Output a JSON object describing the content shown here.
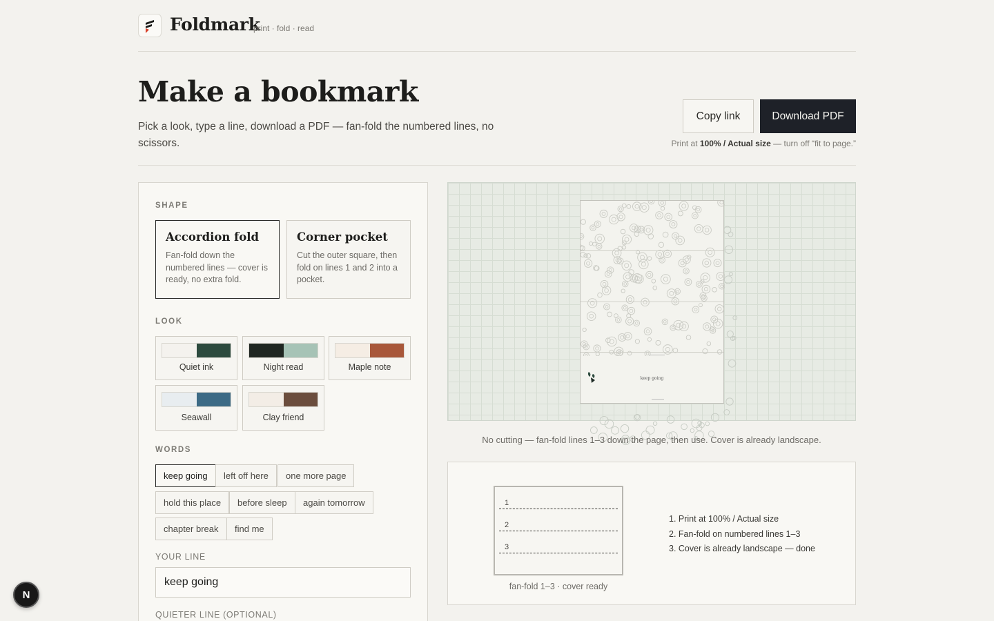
{
  "header": {
    "brand": "Foldmark",
    "tagline": "print · fold · read"
  },
  "hero": {
    "title": "Make a bookmark",
    "subtitle": "Pick a look, type a line, download a PDF — fan-fold the numbered lines, no scissors.",
    "copy_link_label": "Copy link",
    "download_label": "Download PDF",
    "print_note_prefix": "Print at ",
    "print_note_bold": "100% / Actual size",
    "print_note_suffix": " — turn off “fit to page.”"
  },
  "panel": {
    "shape_label": "SHAPE",
    "shapes": [
      {
        "title": "Accordion fold",
        "desc": "Fan-fold down the numbered lines — cover is ready, no extra fold.",
        "selected": true
      },
      {
        "title": "Corner pocket",
        "desc": "Cut the outer square, then fold on lines 1 and 2 into a pocket.",
        "selected": false
      }
    ],
    "look_label": "LOOK",
    "looks": [
      {
        "name": "Quiet ink",
        "colors": [
          "#f4f2ee",
          "#2c4a3e"
        ]
      },
      {
        "name": "Night read",
        "colors": [
          "#1f2621",
          "#a6c3b6"
        ]
      },
      {
        "name": "Maple note",
        "colors": [
          "#f5ede4",
          "#a8573a"
        ]
      },
      {
        "name": "Seawall",
        "colors": [
          "#e8edf0",
          "#3c6a85"
        ]
      },
      {
        "name": "Clay friend",
        "colors": [
          "#f3ede6",
          "#6b4d3d"
        ]
      }
    ],
    "words_label": "WORDS",
    "words": [
      "keep going",
      "left off here",
      "one more page",
      "hold this place",
      "before sleep",
      "again tomorrow",
      "chapter break",
      "find me"
    ],
    "selected_word": "keep going",
    "your_line_label": "YOUR LINE",
    "your_line_value": "keep going",
    "quieter_line_label": "QUIETER LINE (OPTIONAL)"
  },
  "preview": {
    "bookmark_word": "keep going",
    "caption": "No cutting — fan-fold lines 1–3 down the page, then use. Cover is already landscape."
  },
  "instructions": {
    "fold_numbers": [
      "1",
      "2",
      "3"
    ],
    "diagram_caption": "fan-fold 1–3 · cover ready",
    "steps": [
      "1. Print at 100% / Actual size",
      "2. Fan-fold on numbered lines 1–3",
      "3. Cover is already landscape — done"
    ]
  },
  "badge": {
    "letter": "N"
  },
  "colors": {
    "background": "#f3f2ee",
    "primary_button": "#1e2128",
    "accent_red": "#d9412b"
  }
}
